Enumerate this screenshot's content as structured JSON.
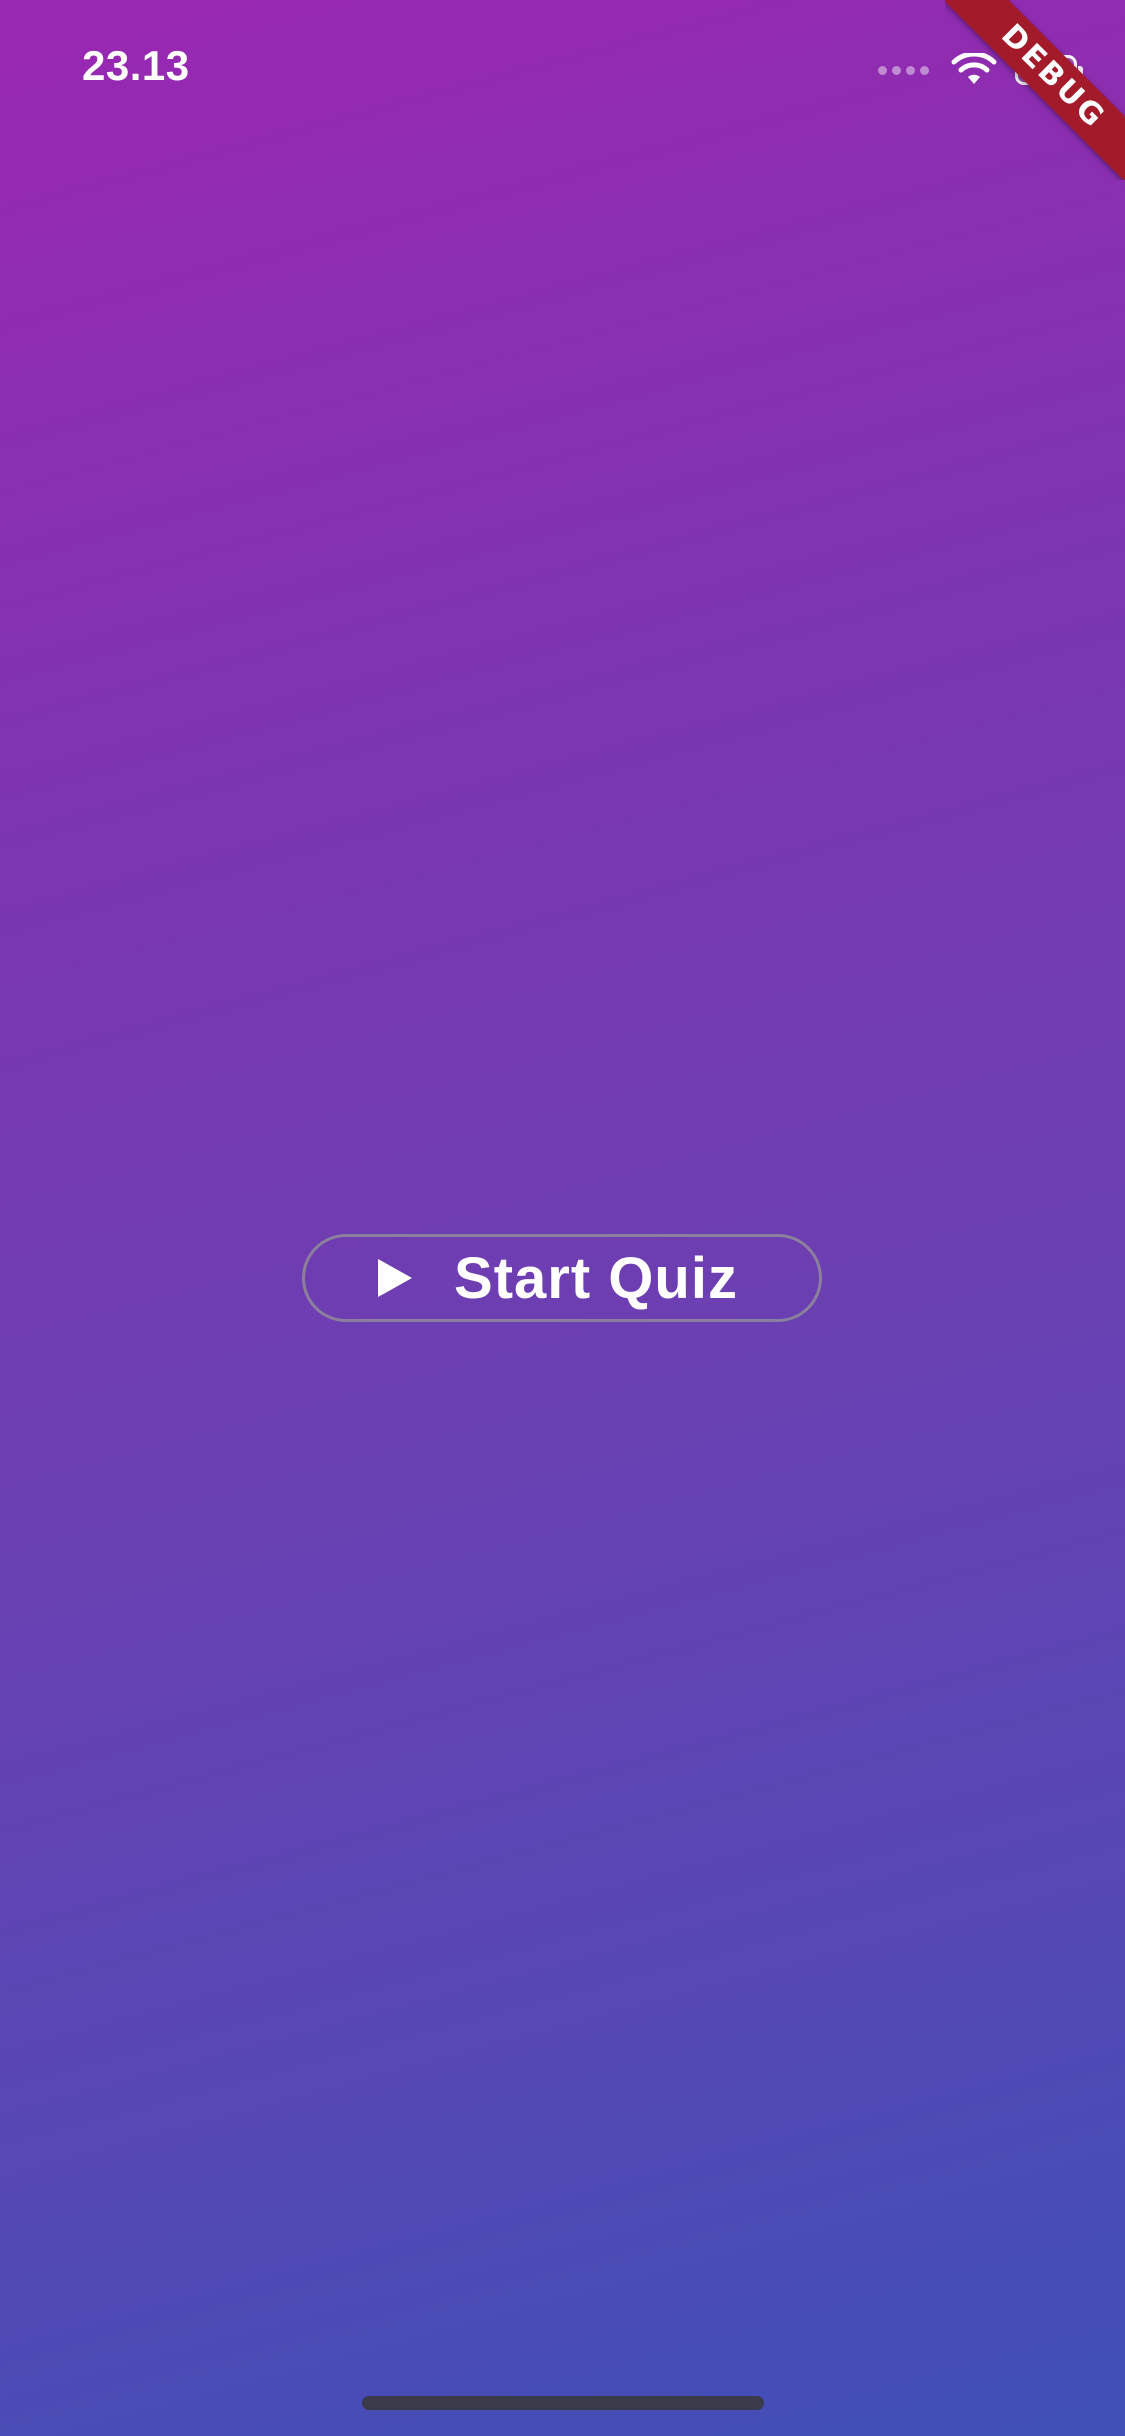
{
  "status_bar": {
    "time": "23.13"
  },
  "debug_banner": {
    "label": "DEBUG",
    "color": "#a31a2a"
  },
  "main": {
    "start_button_label": "Start Quiz",
    "start_button_icon": "play-icon"
  },
  "icons": {
    "wifi": "wifi-icon",
    "battery": "battery-icon",
    "signal": "signal-dots-icon"
  },
  "colors": {
    "gradient_top": "#9a27b1",
    "gradient_bottom": "#3f50b6",
    "text": "#ffffff"
  }
}
